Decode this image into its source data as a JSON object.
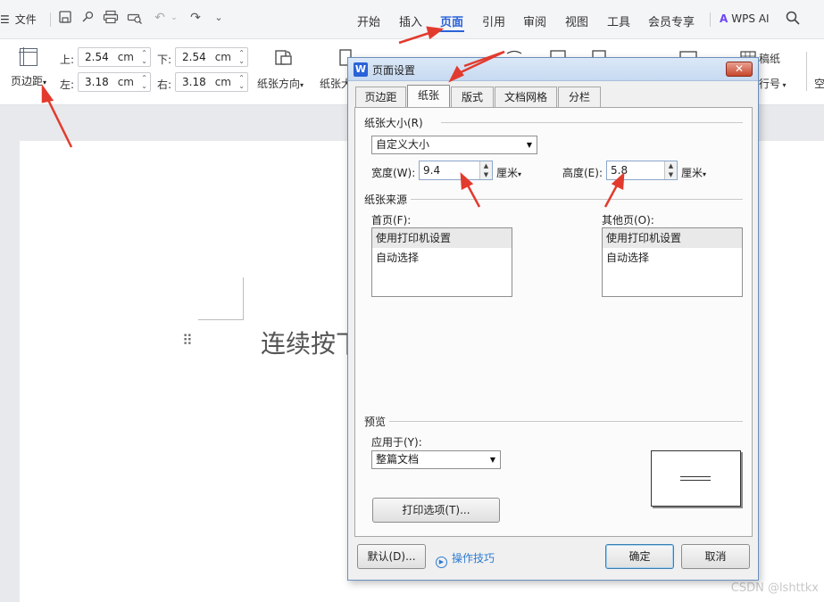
{
  "menubar": {
    "file_label": "文件",
    "tabs": [
      "开始",
      "插入",
      "页面",
      "引用",
      "审阅",
      "视图",
      "工具",
      "会员专享"
    ],
    "active_tab": "页面",
    "wps_ai": "WPS AI"
  },
  "ribbon": {
    "margin_button": "页边距",
    "top_label": "上:",
    "top_value": "2.54",
    "bottom_label": "下:",
    "bottom_value": "2.54",
    "left_label": "左:",
    "left_value": "3.18",
    "right_label": "右:",
    "right_value": "3.18",
    "unit": "cm",
    "orientation": "纸张方向",
    "size_partial": "纸张大",
    "draft_paper": "稿纸",
    "line_number": "行号",
    "empty_partial": "空"
  },
  "document": {
    "text_partial": "连续按下"
  },
  "dialog": {
    "title": "页面设置",
    "tabs": [
      "页边距",
      "纸张",
      "版式",
      "文档网格",
      "分栏"
    ],
    "selected_tab": "纸张",
    "paper_size_group": "纸张大小(R)",
    "paper_size_value": "自定义大小",
    "width_label": "宽度(W):",
    "width_value": "9.4",
    "height_label": "高度(E):",
    "height_value": "5.8",
    "unit": "厘米",
    "paper_source_group": "纸张来源",
    "first_page_label": "首页(F):",
    "other_pages_label": "其他页(O):",
    "source_options": [
      "使用打印机设置",
      "自动选择"
    ],
    "preview_group": "预览",
    "apply_to_label": "应用于(Y):",
    "apply_to_value": "整篇文档",
    "print_options_button": "打印选项(T)...",
    "default_button": "默认(D)...",
    "tips_link": "操作技巧",
    "ok_button": "确定",
    "cancel_button": "取消"
  },
  "watermark": "CSDN @lshttkx",
  "colors": {
    "accent": "#2a62d8",
    "annotation_arrow": "#e23b2e",
    "dialog_border": "#6a8fbf"
  }
}
